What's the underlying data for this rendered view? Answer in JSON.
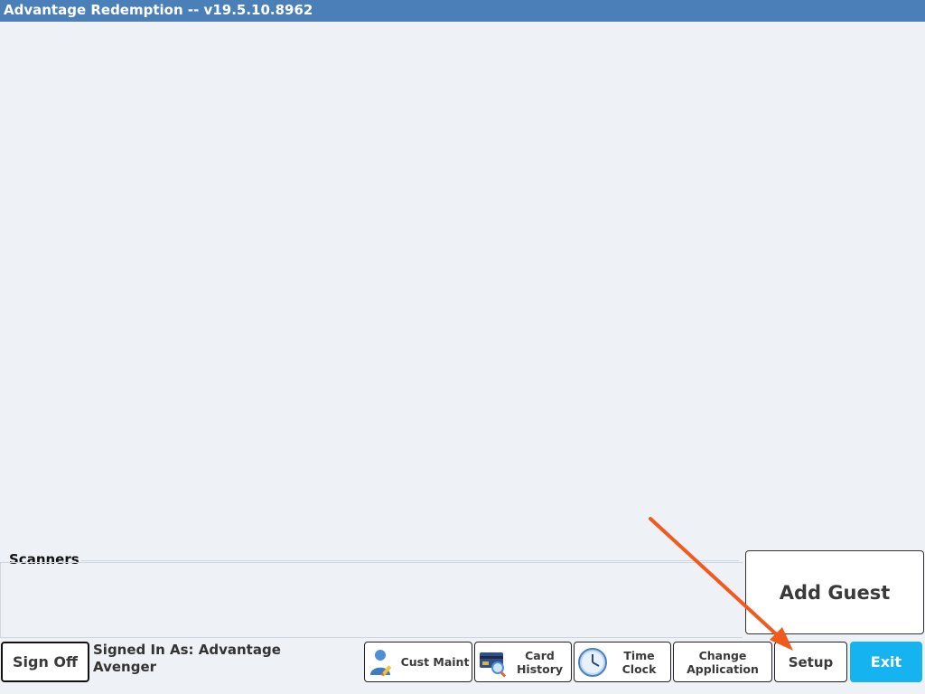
{
  "window": {
    "title": "Advantage Redemption -- v19.5.10.8962"
  },
  "scanners": {
    "label": "Scanners"
  },
  "actions": {
    "add_guest": "Add Guest"
  },
  "footer": {
    "sign_off": "Sign Off",
    "signed_in_as": "Signed In As: Advantage Avenger",
    "cust_maint": "Cust Maint",
    "card_history": "Card History",
    "time_clock": "Time Clock",
    "change_application": "Change Application",
    "setup": "Setup",
    "exit": "Exit"
  },
  "icons": {
    "cust_maint": "user-edit-icon",
    "card_history": "card-search-icon",
    "time_clock": "clock-icon"
  },
  "colors": {
    "titlebar": "#4b7fb8",
    "background": "#eef1f5",
    "exit_button": "#15b4f0",
    "annotation_arrow": "#f25a1d"
  }
}
